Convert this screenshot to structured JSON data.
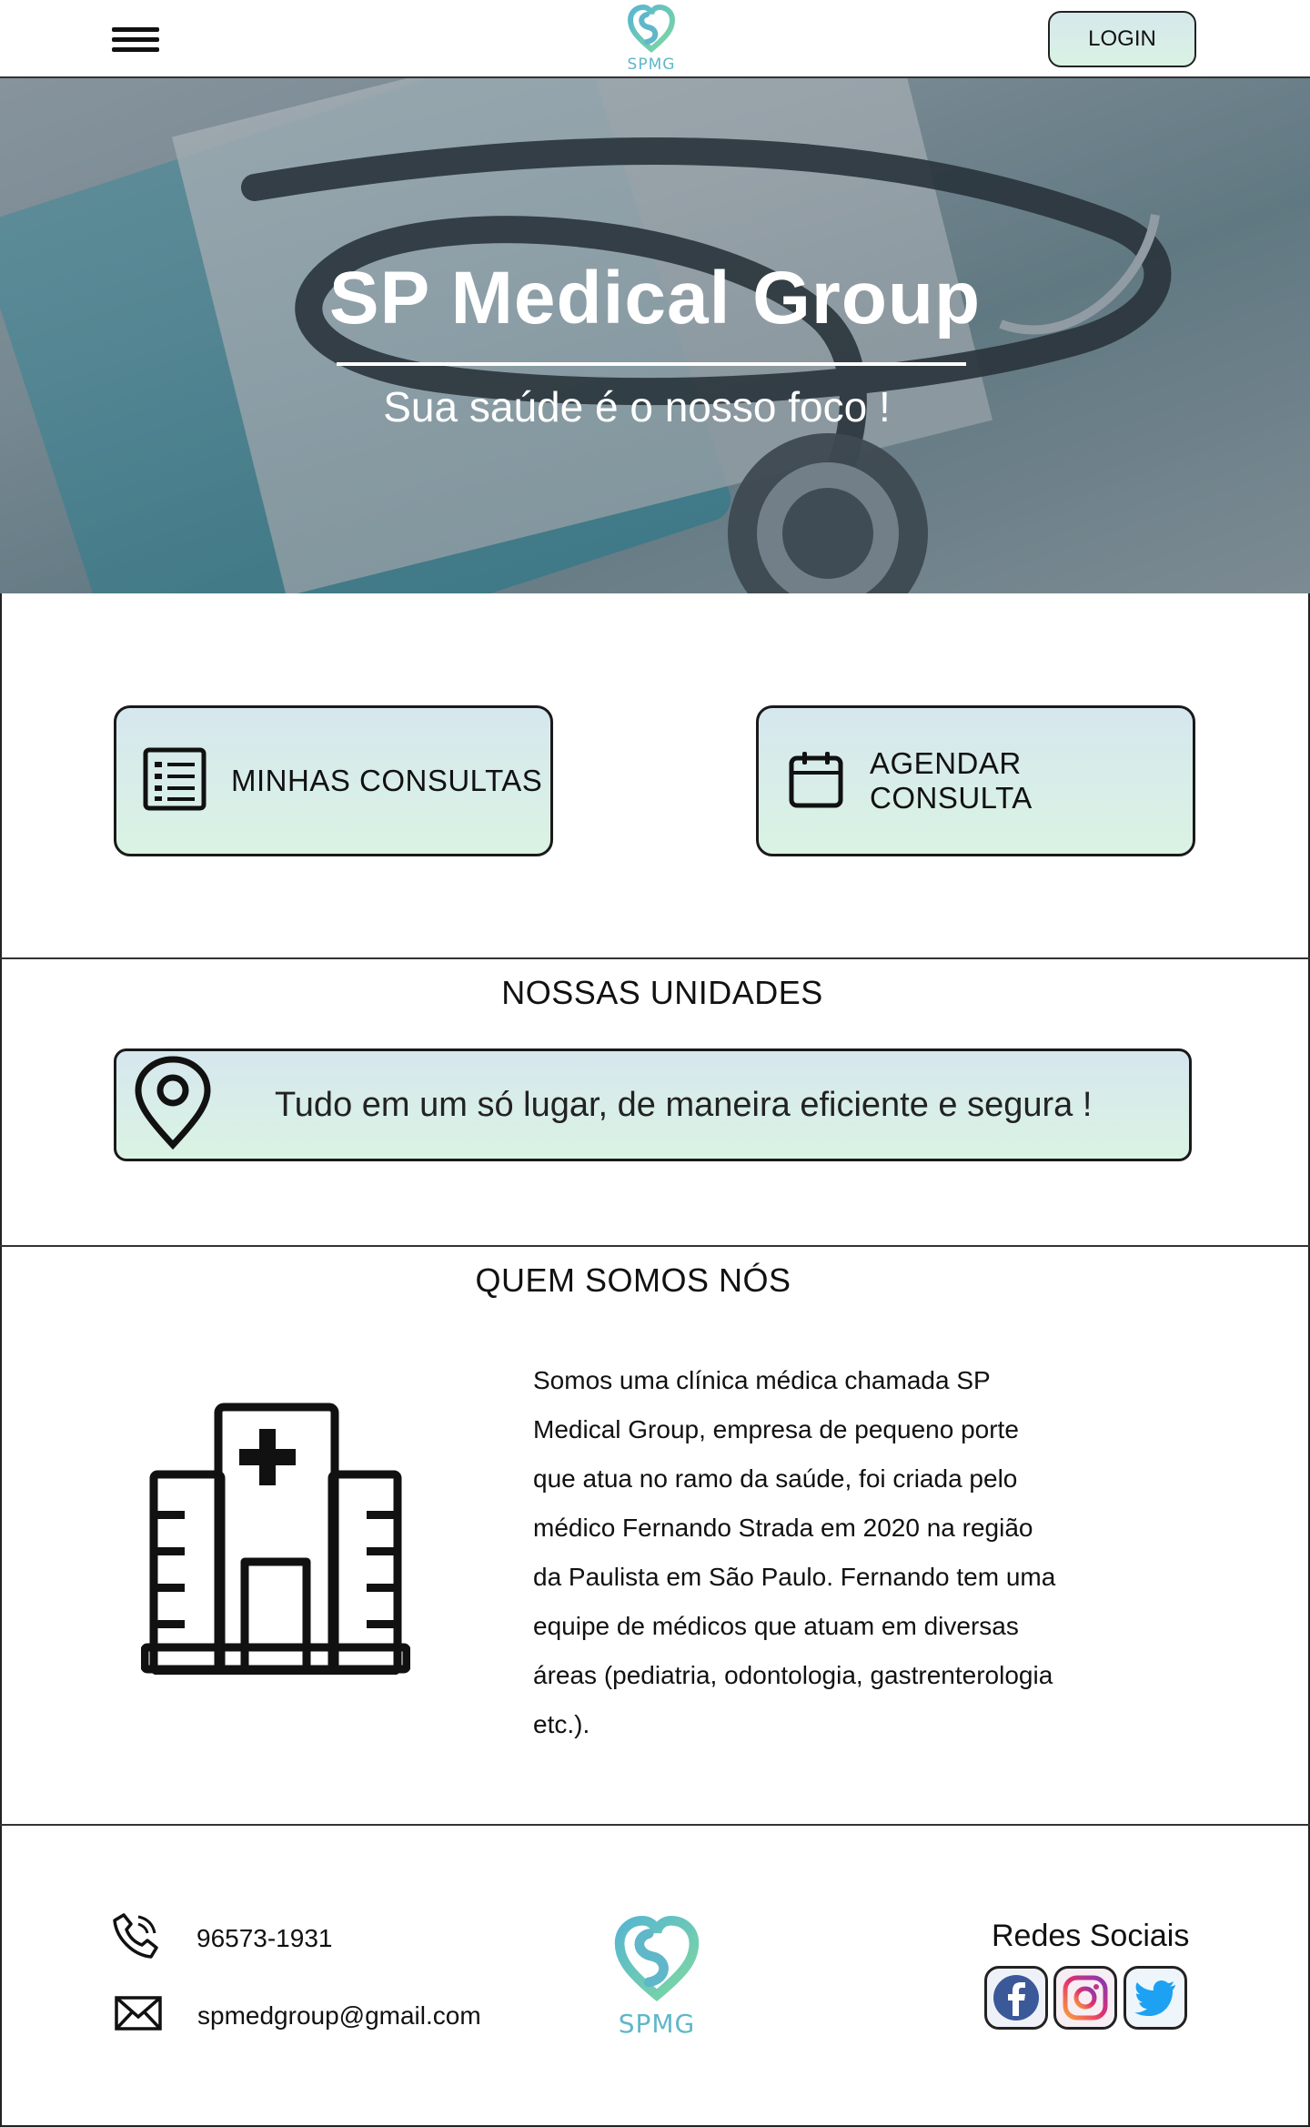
{
  "header": {
    "logo_text": "SPMG",
    "login_label": "LOGIN"
  },
  "hero": {
    "title": "SP Medical Group",
    "subtitle": "Sua saúde é o nosso foco !"
  },
  "actions": {
    "my_appointments": "MINHAS CONSULTAS",
    "schedule": "AGENDAR CONSULTA"
  },
  "units": {
    "title": "NOSSAS UNIDADES",
    "tagline": "Tudo em um só lugar, de maneira eficiente e segura !"
  },
  "about": {
    "title": "QUEM SOMOS NÓS",
    "lines": [
      "Somos uma clínica médica chamada SP",
      "Medical Group, empresa de pequeno porte",
      "que atua no ramo da saúde, foi criada pelo",
      "médico Fernando Strada em 2020 na região",
      "da Paulista em São Paulo. Fernando tem uma",
      "equipe de médicos que atuam em diversas",
      "áreas (pediatria, odontologia, gastrenterologia",
      "etc.)."
    ]
  },
  "footer": {
    "phone": "96573-1931",
    "email": "spmedgroup@gmail.com",
    "logo_text": "SPMG",
    "social_title": "Redes Sociais",
    "social_icons": [
      "facebook-icon",
      "instagram-icon",
      "twitter-icon"
    ]
  },
  "colors": {
    "accent_teal": "#5fb7c9",
    "accent_green": "#7fd6a6",
    "button_gradient_top": "#d6e7ee",
    "button_gradient_bottom": "#daf3e3"
  }
}
